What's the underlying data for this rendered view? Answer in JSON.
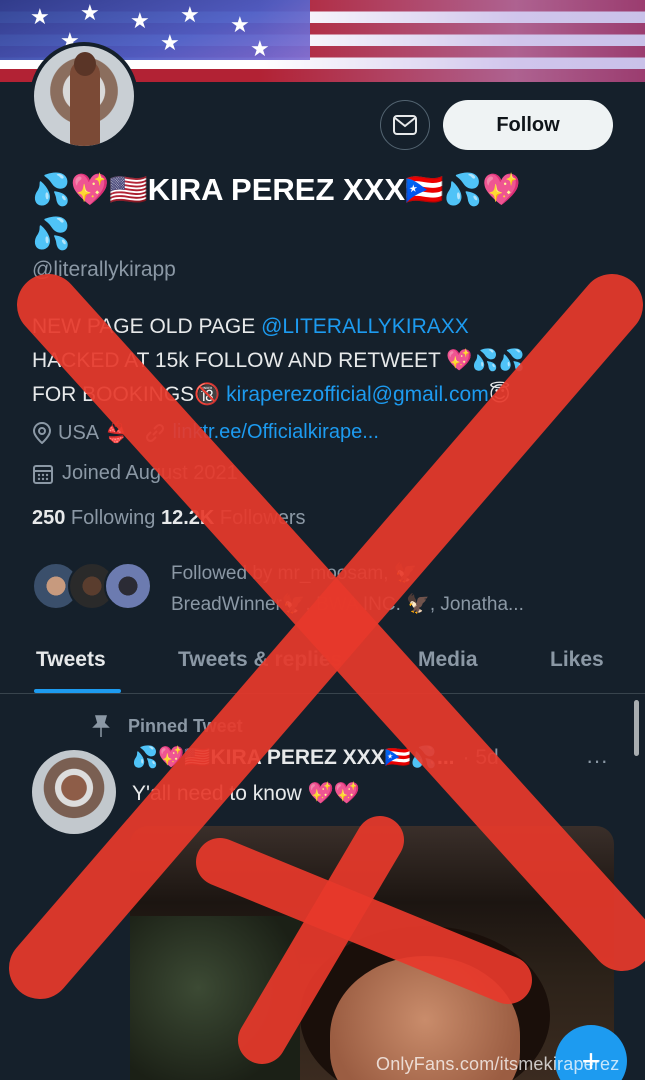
{
  "profile": {
    "name_line1": "💦💖🇺🇸KIRA PEREZ XXX🇵🇷💦💖",
    "name_line2": "💦",
    "handle": "@literallykirapp",
    "follow_label": "Follow",
    "bio_line1_a": "NEW PAGE OLD PAGE ",
    "bio_line1_link": "@LITERALLYKIRAXX",
    "bio_line2": "HACKED AT 15k FOLLOW AND RETWEET 💖💦💦",
    "bio_line3_a": "FOR BOOKINGS🔞 ",
    "bio_line3_link": "kiraperezofficial@gmail.com",
    "bio_line3_b": "😇",
    "location": "USA 👙",
    "website": "linktr.ee/Officialkirape...",
    "joined": "Joined August 2021",
    "following_count": "250",
    "following_label": " Following  ",
    "followers_count": "12.2K",
    "followers_label": " Followers",
    "followed_by_line1": "Followed by mr_moosam, 🦅",
    "followed_by_line2": "BreadWinner🦅, BWA INC. 🦅, Jonatha..."
  },
  "tabs": [
    "Tweets",
    "Tweets & replies",
    "Media",
    "Likes"
  ],
  "pinned": {
    "label": "Pinned Tweet",
    "author": "💦💖🇺🇸KIRA PEREZ XXX🇵🇷💦...",
    "time": "· 5d",
    "more": "···",
    "text": "Y'all need to know 💖💖"
  },
  "fab_icon": "+",
  "watermark": "OnlyFans.com/itsmekiraperez",
  "colors": {
    "background": "#15202b",
    "accent": "#1d9bf0",
    "overlay_x": "#e8392b"
  }
}
